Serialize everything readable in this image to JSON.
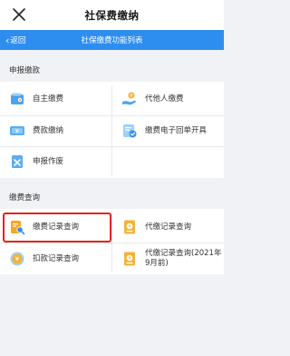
{
  "window": {
    "title": "社保费缴纳"
  },
  "navbar": {
    "back_label": "返回",
    "title": "社保缴费功能列表"
  },
  "sections": [
    {
      "title": "申报缴款",
      "items": [
        {
          "label": "自主缴费",
          "icon": "wallet-icon"
        },
        {
          "label": "代他人缴费",
          "icon": "hand-pay-icon"
        },
        {
          "label": "费款缴纳",
          "icon": "yuan-bill-icon"
        },
        {
          "label": "缴费电子回单开具",
          "icon": "receipt-check-icon"
        },
        {
          "label": "申报作废",
          "icon": "document-void-icon"
        }
      ]
    },
    {
      "title": "缴费查询",
      "items": [
        {
          "label": "缴费记录查询",
          "icon": "record-search-icon"
        },
        {
          "label": "代缴记录查询",
          "icon": "proxy-record-icon"
        },
        {
          "label": "扣款记录查询",
          "icon": "yuan-coin-icon"
        },
        {
          "label": "代缴记录查询(2021年9月前)",
          "icon": "proxy-record-old-icon"
        }
      ]
    }
  ],
  "colors": {
    "accent": "#2e8ef0",
    "highlight": "#e3251b",
    "background": "#f1f2f5"
  }
}
